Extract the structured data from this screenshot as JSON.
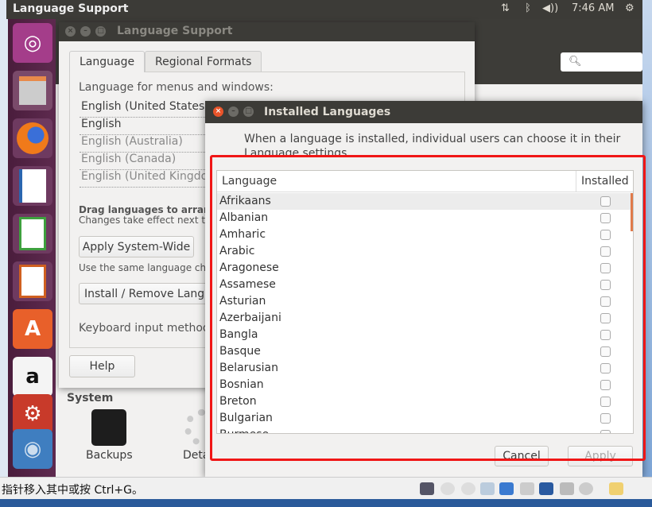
{
  "top_panel": {
    "title": "Language Support",
    "time": "7:46 AM",
    "icons": [
      "network-icon",
      "bluetooth-icon",
      "volume-icon",
      "power-gear-icon"
    ]
  },
  "launcher": [
    "ubuntu-dash-icon",
    "files-icon",
    "firefox-icon",
    "writer-icon",
    "calc-icon",
    "impress-icon",
    "software-center-icon",
    "amazon-icon",
    "system-settings-icon",
    "language-support-icon"
  ],
  "back_window": {
    "section": "System",
    "items": [
      "Backups",
      "Details"
    ]
  },
  "language_support": {
    "title": "Language Support",
    "tabs": [
      "Language",
      "Regional Formats"
    ],
    "label": "Language for menus and windows:",
    "languages": [
      "English (United States)",
      "English",
      "English (Australia)",
      "English (Canada)",
      "English (United Kingdo"
    ],
    "drag_hint": "Drag languages to arrange t",
    "drag_hint2": "Changes take effect next tim",
    "apply_button": "Apply System-Wide",
    "same_hint": "Use the same language choic",
    "install_button": "Install / Remove Langu",
    "keyboard_label": "Keyboard input method",
    "help_button": "Help"
  },
  "installed": {
    "title": "Installed Languages",
    "desc1": "When a language is installed, individual users can choose it in their",
    "desc2": "Language settings.",
    "col_language": "Language",
    "col_installed": "Installed",
    "rows": [
      {
        "name": "Afrikaans",
        "installed": false
      },
      {
        "name": "Albanian",
        "installed": false
      },
      {
        "name": "Amharic",
        "installed": false
      },
      {
        "name": "Arabic",
        "installed": false
      },
      {
        "name": "Aragonese",
        "installed": false
      },
      {
        "name": "Assamese",
        "installed": false
      },
      {
        "name": "Asturian",
        "installed": false
      },
      {
        "name": "Azerbaijani",
        "installed": false
      },
      {
        "name": "Bangla",
        "installed": false
      },
      {
        "name": "Basque",
        "installed": false
      },
      {
        "name": "Belarusian",
        "installed": false
      },
      {
        "name": "Bosnian",
        "installed": false
      },
      {
        "name": "Breton",
        "installed": false
      },
      {
        "name": "Bulgarian",
        "installed": false
      },
      {
        "name": "Burmese",
        "installed": false
      }
    ],
    "cancel": "Cancel",
    "apply": "Apply"
  },
  "statusbar": {
    "text": "指针移入其中或按 Ctrl+G。"
  },
  "colors": {
    "highlight_box": "#f01616",
    "panel": "#3c3b37",
    "launcher": "#5e2a4f"
  }
}
